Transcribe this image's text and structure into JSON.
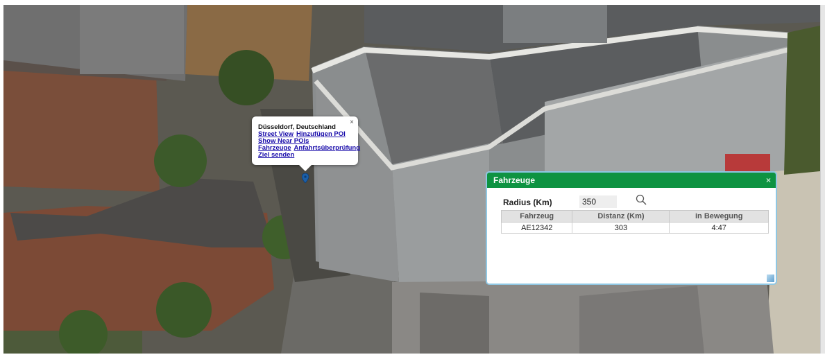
{
  "info_window": {
    "title": "Düsseldorf, Deutschland",
    "links": {
      "street_view": "Street View",
      "add_poi": "Hinzufügen POI",
      "near_pois": "Show Near POIs",
      "vehicles": "Fahrzeuge",
      "approach_check": "Anfahrtsüberprüfung",
      "send_target": "Ziel senden"
    },
    "close_glyph": "×"
  },
  "dialog": {
    "title": "Fahrzeuge",
    "close_glyph": "×",
    "radius_label": "Radius (Km)",
    "radius_value": "350",
    "table": {
      "headers": [
        "Fahrzeug",
        "Distanz (Km)",
        "in Bewegung"
      ],
      "rows": [
        [
          "AE12342",
          "303",
          "4:47"
        ]
      ]
    }
  },
  "colors": {
    "dialog_titlebar": "#0e9342",
    "dialog_border": "#8fc7e3",
    "link": "#1a0dab",
    "pin": "#1c5fa8"
  },
  "icons": {
    "search": "magnifier-icon",
    "pin": "map-marker-icon"
  }
}
